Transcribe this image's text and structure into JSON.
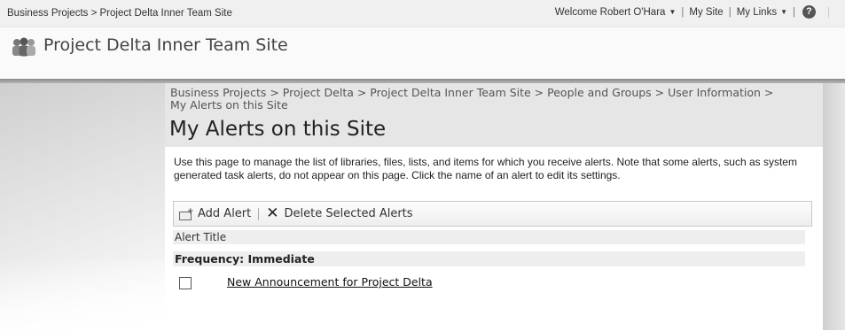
{
  "topbar": {
    "breadcrumb": "Business Projects > Project Delta Inner Team Site",
    "welcome": "Welcome Robert O'Hara",
    "my_site": "My Site",
    "my_links": "My Links",
    "divider": "|",
    "help_glyph": "?"
  },
  "site": {
    "title": "Project Delta Inner Team Site",
    "icon": "people-group-icon"
  },
  "page": {
    "breadcrumb": "Business Projects > Project Delta > Project Delta Inner Team Site > People and Groups > User Information > My Alerts on this Site",
    "title": "My Alerts on this Site",
    "description": "Use this page to manage the list of libraries, files, lists, and items for which you receive alerts. Note that some alerts, such as system generated task alerts, do not appear on this page. Click the name of an alert to edit its settings."
  },
  "toolbar": {
    "add_alert": "Add Alert",
    "separator": "|",
    "delete_selected": "Delete Selected Alerts",
    "add_icon": "add-alert-icon",
    "delete_icon": "delete-x-icon"
  },
  "list": {
    "column_header": "Alert Title",
    "group_header": "Frequency: Immediate",
    "rows": [
      {
        "title": "New Announcement for Project Delta",
        "checked": false
      }
    ]
  }
}
